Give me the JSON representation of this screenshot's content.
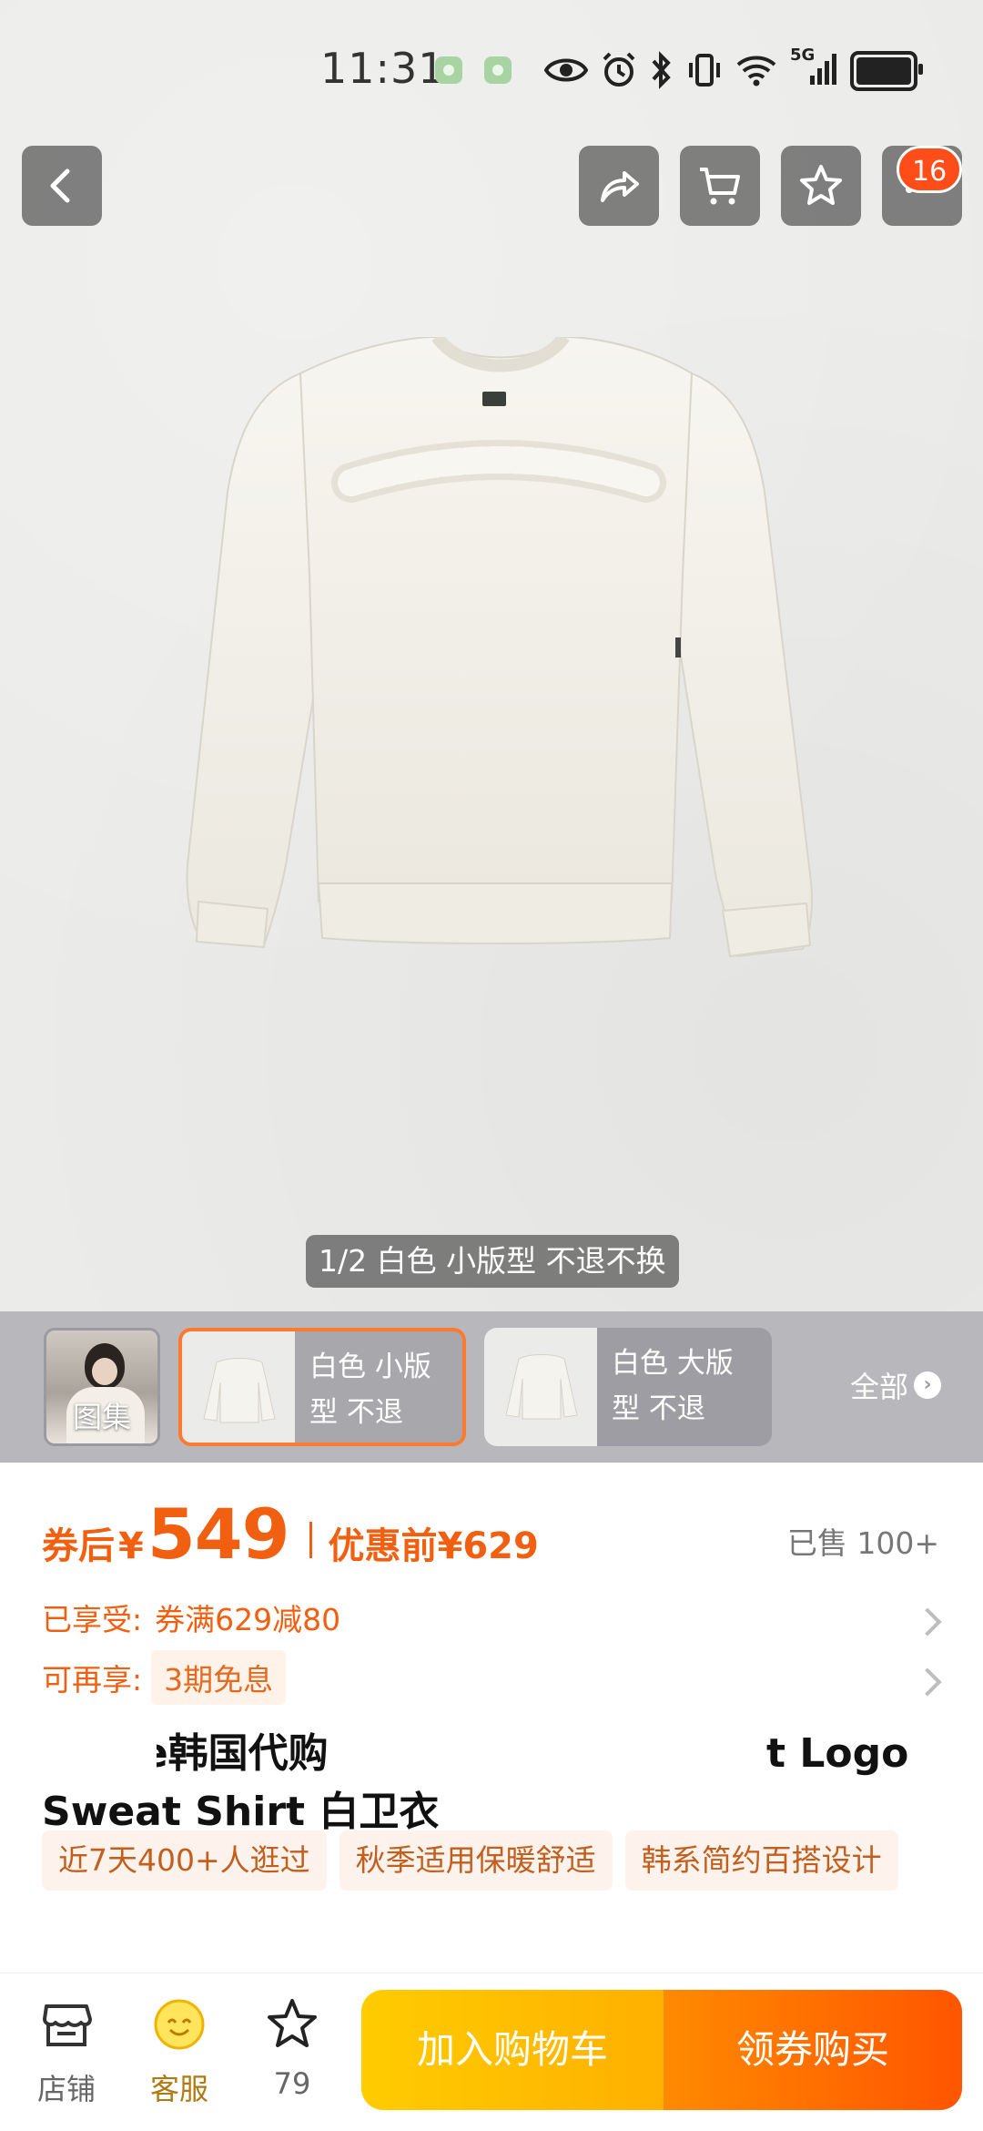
{
  "status_bar": {
    "time": "11:31",
    "network": "5G",
    "icons": [
      "eye-icon",
      "alarm-icon",
      "bluetooth-icon",
      "vibrate-icon",
      "wifi-icon",
      "signal-icon",
      "battery-icon"
    ]
  },
  "header": {
    "back_icon": "chevron-left-icon",
    "actions": [
      "share-icon",
      "cart-icon",
      "star-icon",
      "more-icon"
    ],
    "message_badge": "16"
  },
  "gallery": {
    "caption": "1/2 白色 小版型  不退不换",
    "gallery_label": "图集",
    "variants": [
      {
        "label": "白色 小版型  不退",
        "selected": true
      },
      {
        "label": "白色 大版型  不退",
        "selected": false
      }
    ],
    "all_label": "全部"
  },
  "price": {
    "prefix": "券后",
    "symbol": "¥",
    "amount": "549",
    "original": "优惠前¥629",
    "sold": "已售 100+",
    "accent_color": "#f06010"
  },
  "perks": {
    "enjoyed_key": "已享受:",
    "enjoyed_value": "券满629减80",
    "more_key": "可再享:",
    "more_value": "3期免息"
  },
  "product": {
    "title": "t nice韩国代购                         t Logo Sweat Shirt 白卫衣",
    "title_line1_left": "t nice韩国代购",
    "title_line1_right": "t Logo",
    "title_line2": "Sweat Shirt 白卫衣",
    "tags": [
      "近7天400+人逛过",
      "秋季适用保暖舒适",
      "韩系简约百搭设计"
    ]
  },
  "bottom_bar": {
    "store_label": "店铺",
    "service_label": "客服",
    "favorite_count": "79",
    "add_to_cart": "加入购物车",
    "buy_with_coupon": "领券购买"
  }
}
